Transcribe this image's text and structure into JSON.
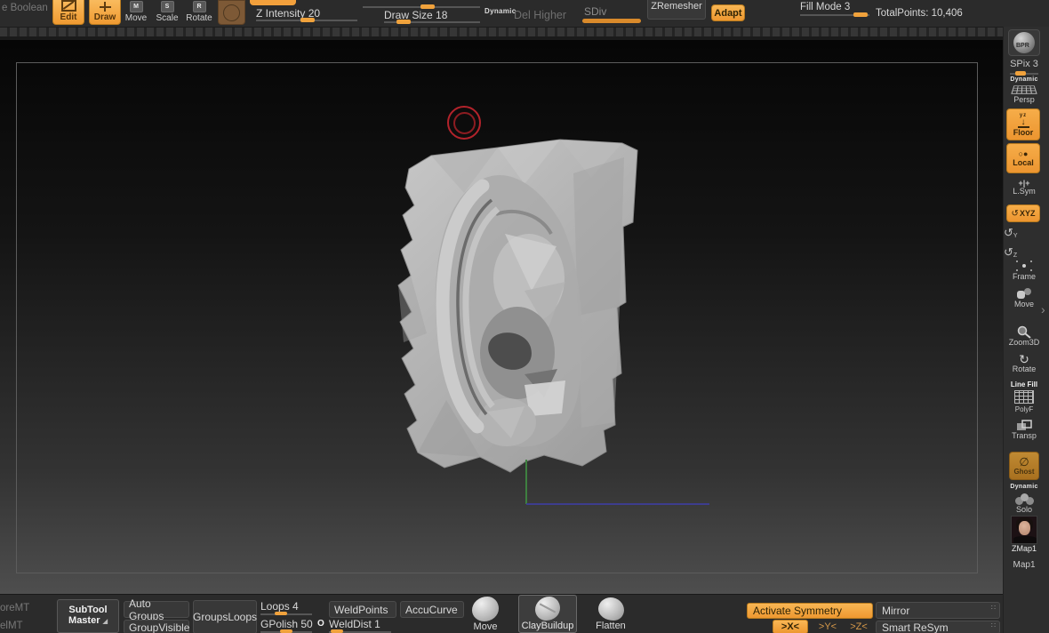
{
  "topbar": {
    "boolean_label": "e Boolean",
    "edit": "Edit",
    "draw": "Draw",
    "move": "Move",
    "scale": "Scale",
    "rotate": "Rotate",
    "move_key": "M",
    "scale_key": "S",
    "rotate_key": "R",
    "z_intensity": "Z Intensity 20",
    "draw_size": "Draw Size 18",
    "dynamic": "Dynamic",
    "del_higher": "Del Higher",
    "sdiv": "SDiv",
    "zremesher": "ZRemesher",
    "adapt": "Adapt",
    "fill_mode": "Fill Mode 3",
    "total_points": "TotalPoints: 10,406"
  },
  "sidebar": {
    "bpr": "BPR",
    "spix": "SPix 3",
    "dynamic_persp": "Dynamic",
    "persp": "Persp",
    "floor_axes": "yz",
    "floor": "Floor",
    "local": "Local",
    "lsym_icon": "+|+",
    "lsym": "L.Sym",
    "xyz_glyph": "↺",
    "xyz": "XYZ",
    "rot_y_glyph": "↺",
    "rot_y": "Y",
    "rot_z_glyph": "↺",
    "rot_z": "Z",
    "frame": "Frame",
    "move3d": "Move",
    "zoom3d": "Zoom3D",
    "rotate3d_glyph": "↻",
    "rotate3d": "Rotate",
    "line_fill": "Line Fill",
    "polyf": "PolyF",
    "transp": "Transp",
    "ghost_glyph": "∅",
    "ghost": "Ghost",
    "dynamic_solo": "Dynamic",
    "solo": "Solo",
    "zmap": "ZMap1",
    "map": "Map1",
    "tray_arrow": "›"
  },
  "bottombar": {
    "store_mt": "oreMT",
    "del_mt": "elMT",
    "subtool_line1": "SubTool",
    "subtool_line2": "Master",
    "subtool_corner": "◢",
    "auto_groups": "Auto Groups",
    "group_visible": "GroupVisible",
    "groups_loops": "GroupsLoops",
    "loops": "Loops 4",
    "gpolish": "GPolish 50",
    "radio_o": "O",
    "weld_points": "WeldPoints",
    "weld_dist": "WeldDist 1",
    "accu_curve": "AccuCurve",
    "brushes": {
      "move": "Move",
      "clay": "ClayBuildup",
      "flatten": "Flatten"
    },
    "activate_symmetry": "Activate Symmetry",
    "sym_x": ">X<",
    "sym_y": ">Y<",
    "sym_z": ">Z<",
    "mirror": "Mirror",
    "smart_resym": "Smart ReSym",
    "mini_glyph": "∷"
  },
  "colors": {
    "accent_orange": "#f0a23c",
    "brush_brown": "#7d5936",
    "cursor_red": "#b3232b",
    "axis_green": "#3e8040",
    "axis_blue": "#3d3d8e"
  }
}
